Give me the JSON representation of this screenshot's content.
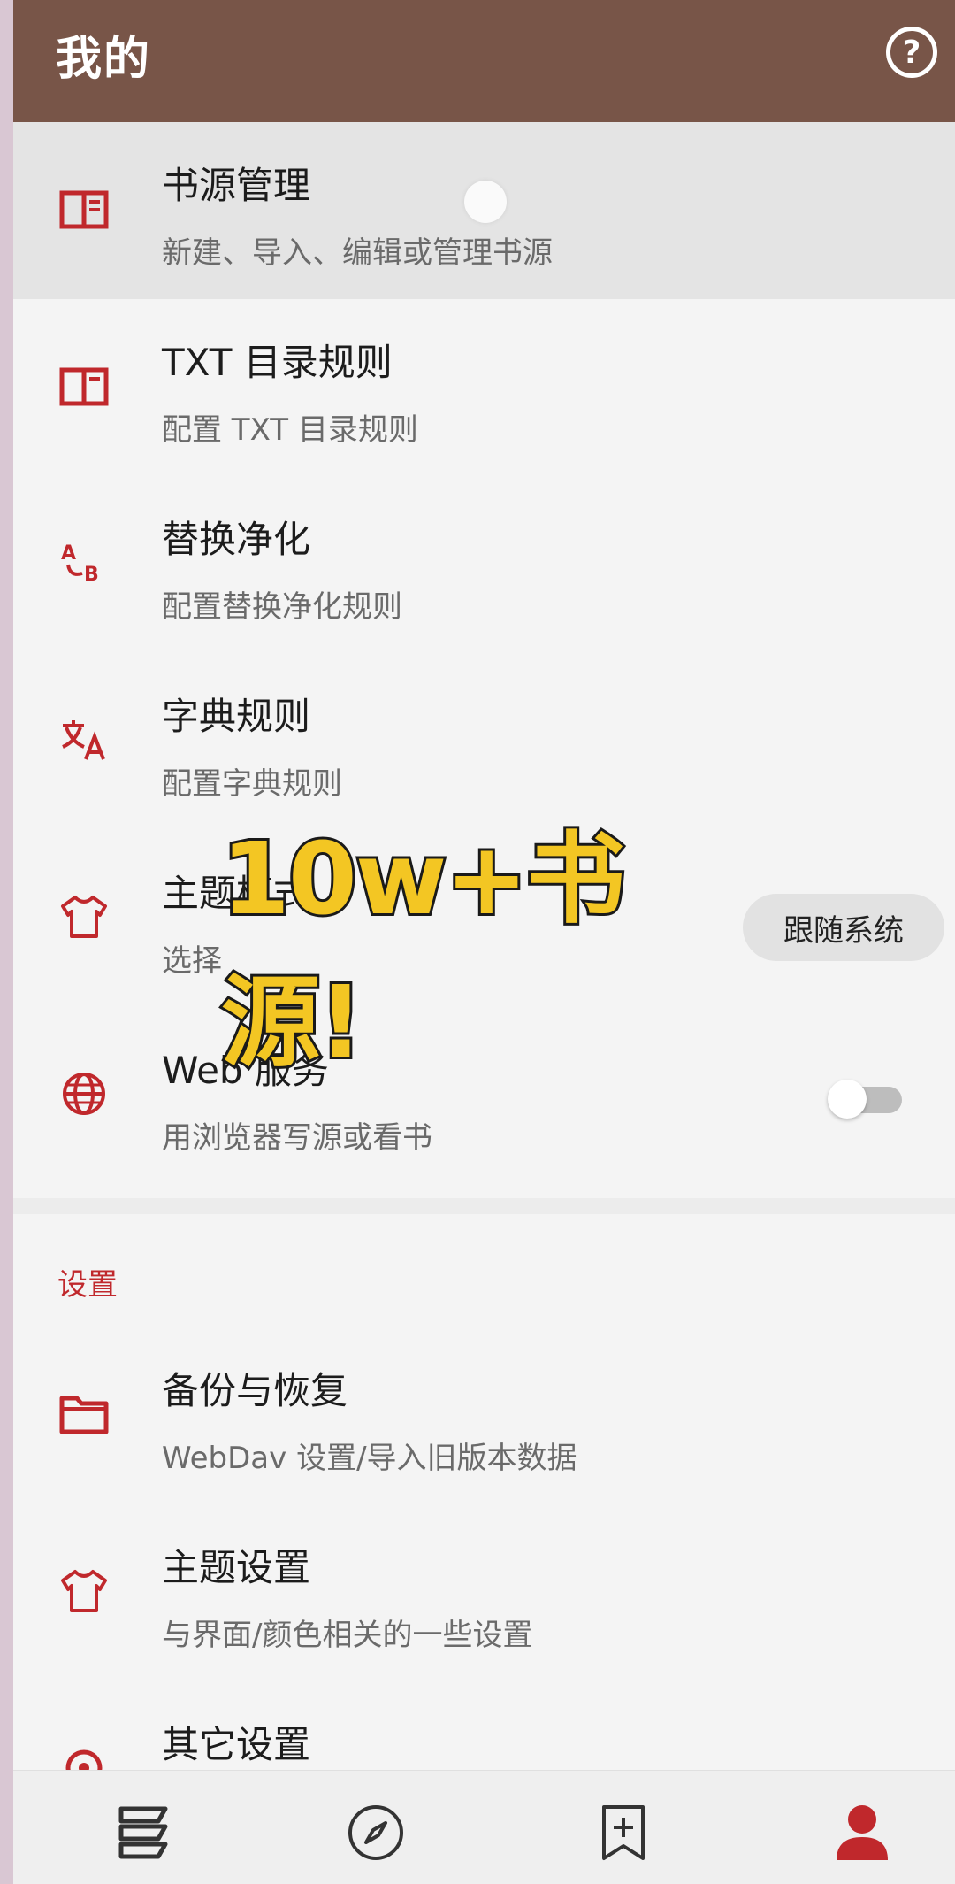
{
  "header": {
    "title": "我的",
    "help_icon": "help-circle-icon",
    "help_glyph": "?"
  },
  "colors": {
    "header_bg": "#785548",
    "accent": "#c0282c",
    "overlay_text": "#f3c623"
  },
  "main_items": [
    {
      "title": "书源管理",
      "subtitle": "新建、导入、编辑或管理书源",
      "icon": "book-open-icon"
    },
    {
      "title": "TXT 目录规则",
      "subtitle": "配置 TXT 目录规则",
      "icon": "book-open-icon"
    },
    {
      "title": "替换净化",
      "subtitle": "配置替换净化规则",
      "icon": "find-replace-icon"
    },
    {
      "title": "字典规则",
      "subtitle": "配置字典规则",
      "icon": "translate-icon"
    },
    {
      "title": "主题模式",
      "subtitle": "选择",
      "icon": "shirt-icon",
      "value": "跟随系统"
    },
    {
      "title": "Web 服务",
      "subtitle": "用浏览器写源或看书",
      "icon": "globe-icon",
      "switch_on": false
    }
  ],
  "settings_section": {
    "label": "设置",
    "items": [
      {
        "title": "备份与恢复",
        "subtitle": "WebDav 设置/导入旧版本数据",
        "icon": "folder-icon"
      },
      {
        "title": "主题设置",
        "subtitle": "与界面/颜色相关的一些设置",
        "icon": "shirt-icon"
      },
      {
        "title": "其它设置",
        "subtitle": "",
        "icon": "settings-icon"
      }
    ]
  },
  "overlay_caption": "10w+书源!",
  "bottom_nav": [
    {
      "name": "bookshelf",
      "icon": "bookshelf-icon",
      "active": false
    },
    {
      "name": "explore",
      "icon": "compass-icon",
      "active": false
    },
    {
      "name": "rss",
      "icon": "bookmark-add-icon",
      "active": false
    },
    {
      "name": "my",
      "icon": "person-icon",
      "active": true
    }
  ]
}
